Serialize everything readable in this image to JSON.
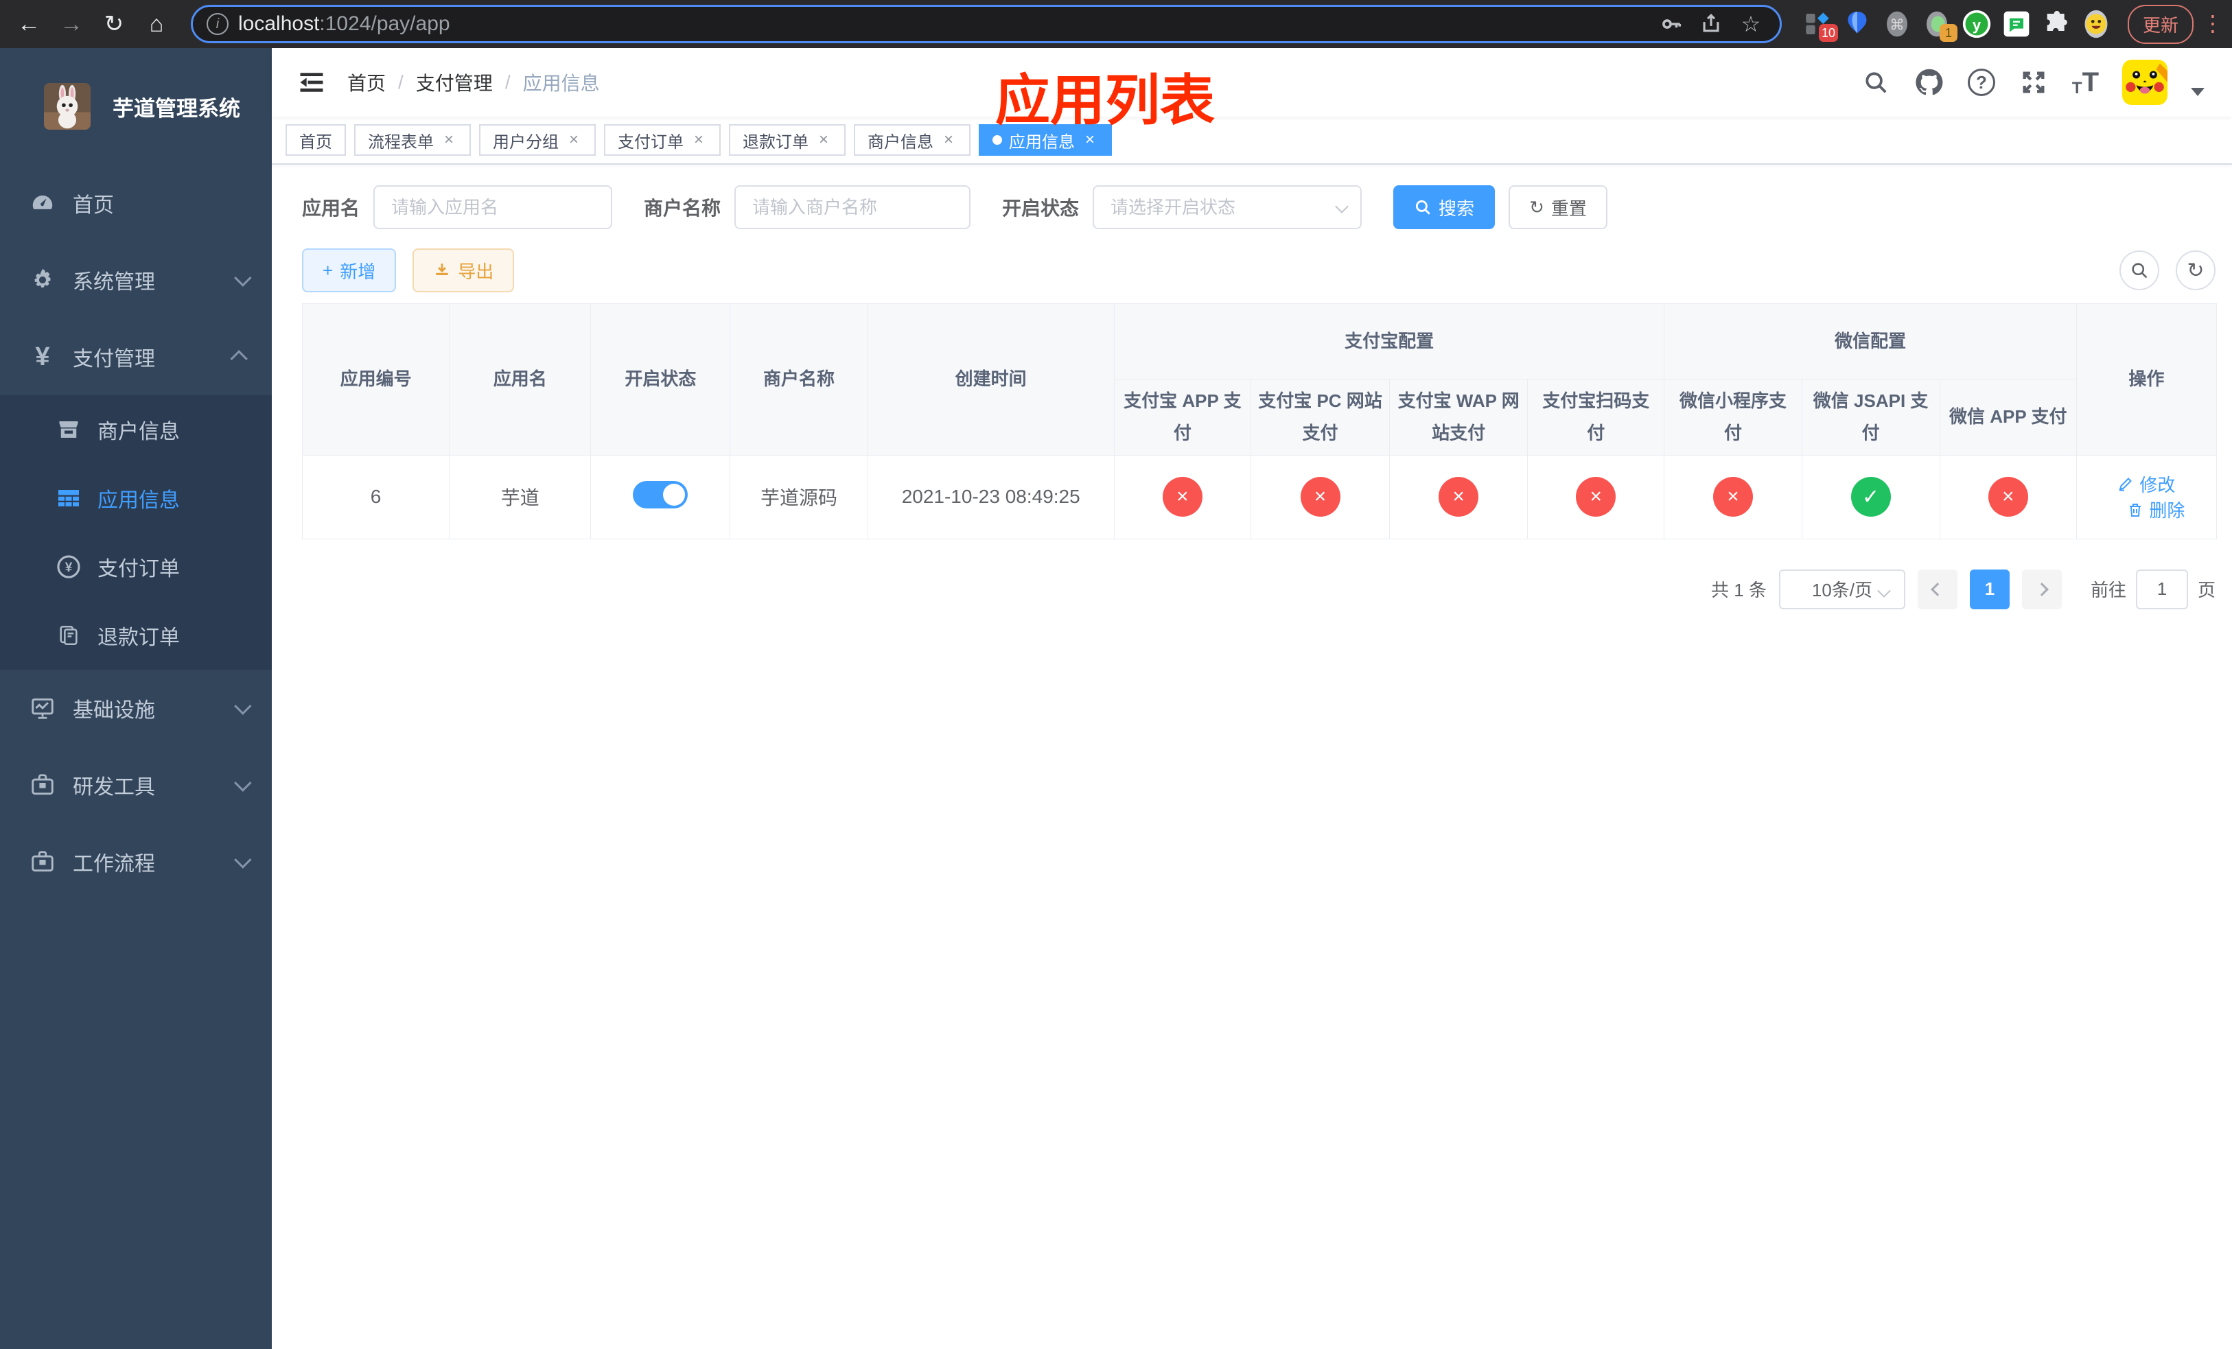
{
  "browser": {
    "url_host": "localhost",
    "url_path": ":1024/pay/app",
    "ext_badge_1": "10",
    "ext_badge_2": "1",
    "update_label": "更新"
  },
  "sidebar": {
    "title": "芋道管理系统",
    "home": "首页",
    "system": "系统管理",
    "payment": "支付管理",
    "sub_merchant": "商户信息",
    "sub_app": "应用信息",
    "sub_pay_order": "支付订单",
    "sub_refund_order": "退款订单",
    "infra": "基础设施",
    "dev_tools": "研发工具",
    "workflow": "工作流程"
  },
  "header": {
    "breadcrumb": [
      "首页",
      "支付管理",
      "应用信息"
    ],
    "overlay_title": "应用列表"
  },
  "tabs": [
    {
      "label": "首页"
    },
    {
      "label": "流程表单"
    },
    {
      "label": "用户分组"
    },
    {
      "label": "支付订单"
    },
    {
      "label": "退款订单"
    },
    {
      "label": "商户信息"
    },
    {
      "label": "应用信息"
    }
  ],
  "icons": {
    "close": "×",
    "plus": "+",
    "refresh": "↻",
    "star": "☆",
    "command": "⌘",
    "home": "⌂",
    "back": "←",
    "forward": "→",
    "dots": "⋮",
    "ext_y": "y"
  },
  "filters": {
    "app_name_label": "应用名",
    "app_name_placeholder": "请输入应用名",
    "merchant_label": "商户名称",
    "merchant_placeholder": "请输入商户名称",
    "status_label": "开启状态",
    "status_placeholder": "请选择开启状态",
    "search_label": "搜索",
    "reset_label": "重置"
  },
  "toolbar": {
    "add_label": "新增",
    "export_label": "导出"
  },
  "table": {
    "columns": [
      "应用编号",
      "应用名",
      "开启状态",
      "商户名称",
      "创建时间"
    ],
    "group_alipay": "支付宝配置",
    "group_wechat": "微信配置",
    "pay_columns": [
      "支付宝 APP 支付",
      "支付宝 PC 网站支付",
      "支付宝 WAP 网站支付",
      "支付宝扫码支付",
      "微信小程序支付",
      "微信 JSAPI 支付",
      "微信 APP 支付"
    ],
    "op_column": "操作",
    "status_icons": {
      "ok": "✓",
      "no": "×"
    },
    "row": {
      "id": "6",
      "name": "芋道",
      "enabled": true,
      "merchant": "芋道源码",
      "created": "2021-10-23 08:49:25",
      "statuses": [
        false,
        false,
        false,
        false,
        false,
        true,
        false
      ],
      "edit_label": "修改",
      "delete_label": "删除"
    }
  },
  "pagination": {
    "total": "共 1 条",
    "page_size": "10条/页",
    "page": "1",
    "goto_label": "前往",
    "goto_value": "1",
    "page_suffix": "页"
  }
}
